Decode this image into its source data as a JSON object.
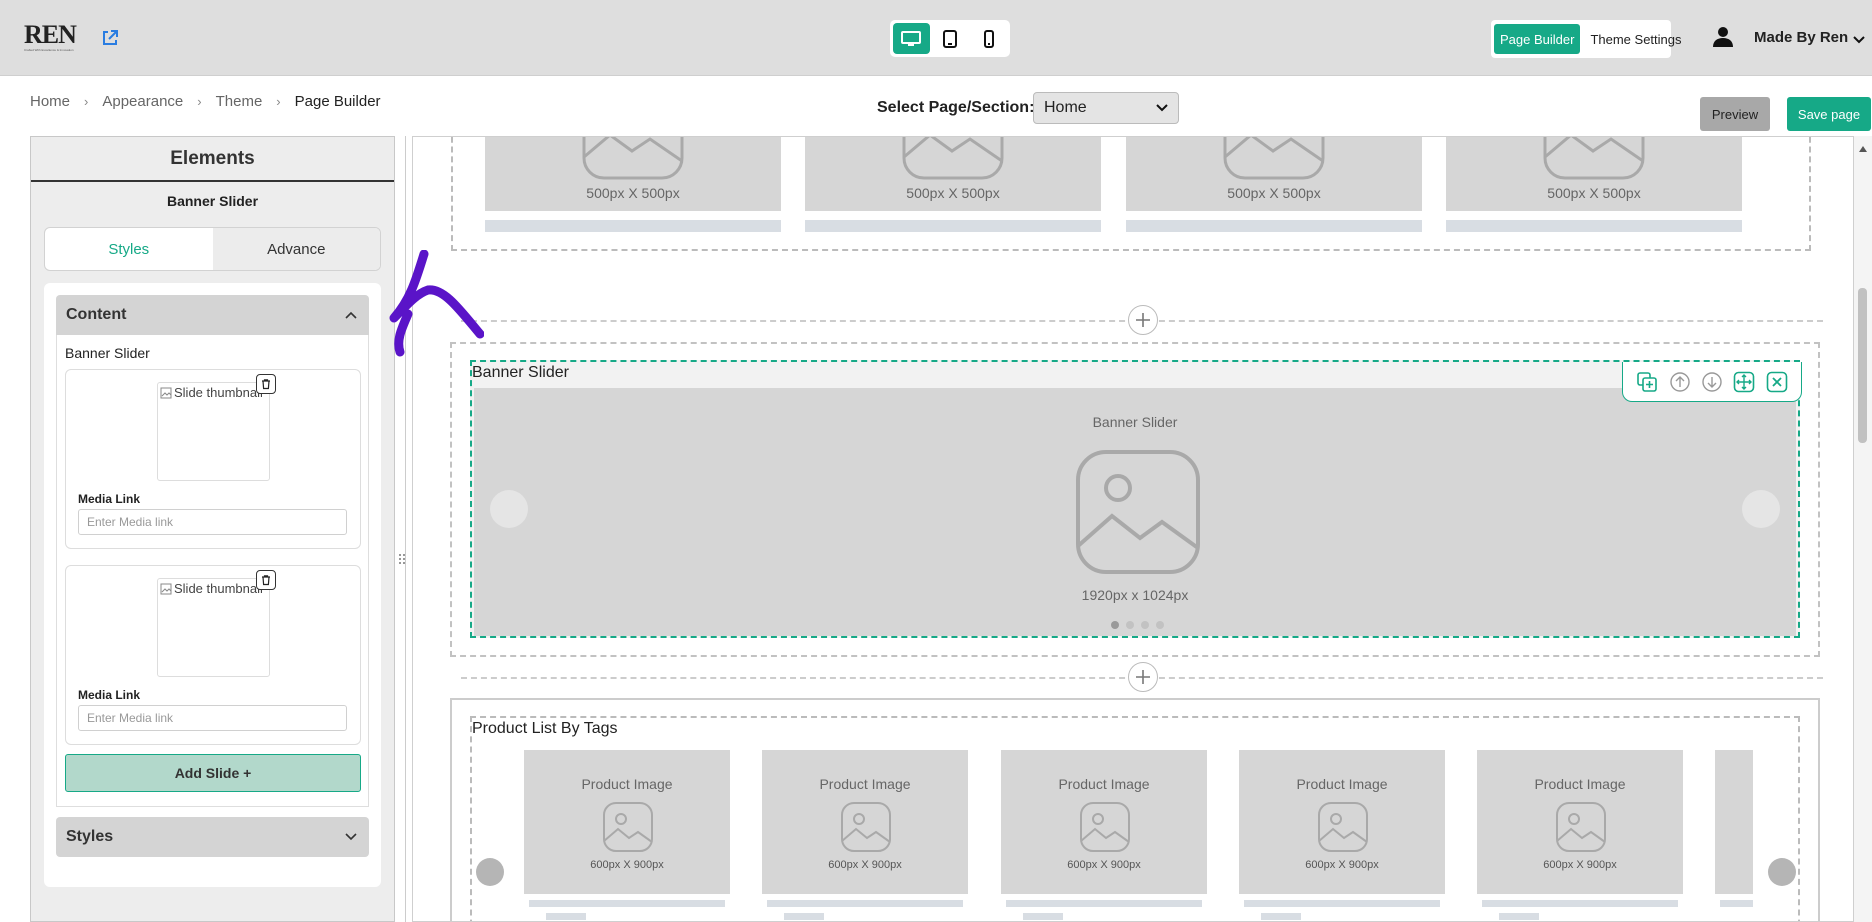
{
  "header": {
    "logo_text": "REN",
    "logo_tagline": "Crafted With Excellence & Innovation",
    "mode_buttons": [
      "Page Builder",
      "Theme Settings"
    ],
    "user_name": "Made By Ren"
  },
  "breadcrumb": [
    "Home",
    "Appearance",
    "Theme",
    "Page Builder"
  ],
  "page_select": {
    "label": "Select Page/Section:",
    "value": "Home"
  },
  "actions": {
    "preview": "Preview",
    "save": "Save page"
  },
  "panel": {
    "title": "Elements",
    "subtitle": "Banner Slider",
    "tabs": [
      "Styles",
      "Advance"
    ],
    "content_section": "Content",
    "content_label": "Banner Slider",
    "slides": [
      {
        "thumb_alt": "Slide thumbnail",
        "media_label": "Media Link",
        "media_placeholder": "Enter Media link"
      },
      {
        "thumb_alt": "Slide thumbnail",
        "media_label": "Media Link",
        "media_placeholder": "Enter Media link"
      }
    ],
    "add_slide": "Add Slide +",
    "styles_section": "Styles"
  },
  "canvas": {
    "top_section": {
      "dims": [
        "500px X 500px",
        "500px X 500px",
        "500px X 500px",
        "500px X 500px"
      ]
    },
    "banner": {
      "title": "Banner Slider",
      "label": "Banner Slider",
      "dims": "1920px x 1024px",
      "pages": 4,
      "active_page": 1
    },
    "products": {
      "title": "Product List By Tags",
      "cards": [
        {
          "label": "Product Image",
          "dims": "600px X 900px"
        },
        {
          "label": "Product Image",
          "dims": "600px X 900px"
        },
        {
          "label": "Product Image",
          "dims": "600px X 900px"
        },
        {
          "label": "Product Image",
          "dims": "600px X 900px"
        },
        {
          "label": "Product Image",
          "dims": "600px X 900px"
        }
      ]
    }
  },
  "colors": {
    "accent": "#16a987",
    "topbar": "#dedede",
    "placeholder": "#d6d6d6",
    "annotation": "#5a14c8"
  }
}
